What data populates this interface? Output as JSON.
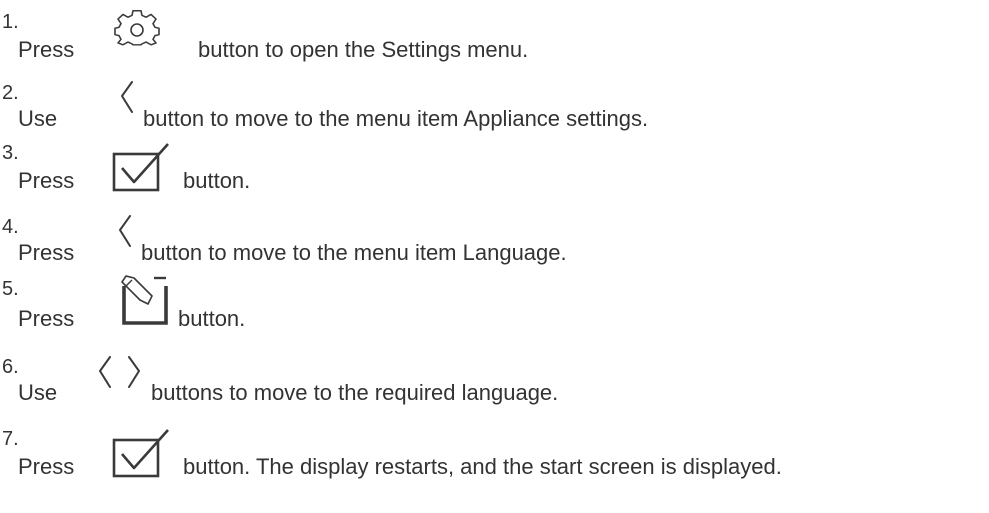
{
  "steps": [
    {
      "number": "1.",
      "before": "Press",
      "icons": [
        "gear-icon"
      ],
      "after": "button to open the Settings menu."
    },
    {
      "number": "2.",
      "before": "Use",
      "icons": [
        "chevron-left-icon"
      ],
      "after": "button to move to the menu item Appliance settings."
    },
    {
      "number": "3.",
      "before": "Press",
      "icons": [
        "checkbox-check-icon"
      ],
      "after": "button."
    },
    {
      "number": "4.",
      "before": "Press",
      "icons": [
        "chevron-left-icon"
      ],
      "after": "button to move to the menu item Language."
    },
    {
      "number": "5.",
      "before": "Press",
      "icons": [
        "edit-pencil-icon"
      ],
      "after": "button."
    },
    {
      "number": "6.",
      "before": "Use",
      "icons": [
        "chevron-left-icon",
        "chevron-right-icon"
      ],
      "after": "buttons to move to the required language."
    },
    {
      "number": "7.",
      "before": "Press",
      "icons": [
        "checkbox-check-icon"
      ],
      "after": "button. The display restarts, and the start screen is displayed."
    }
  ],
  "colors": {
    "text": "#333333",
    "icon_stroke": "#3a3a3a"
  }
}
